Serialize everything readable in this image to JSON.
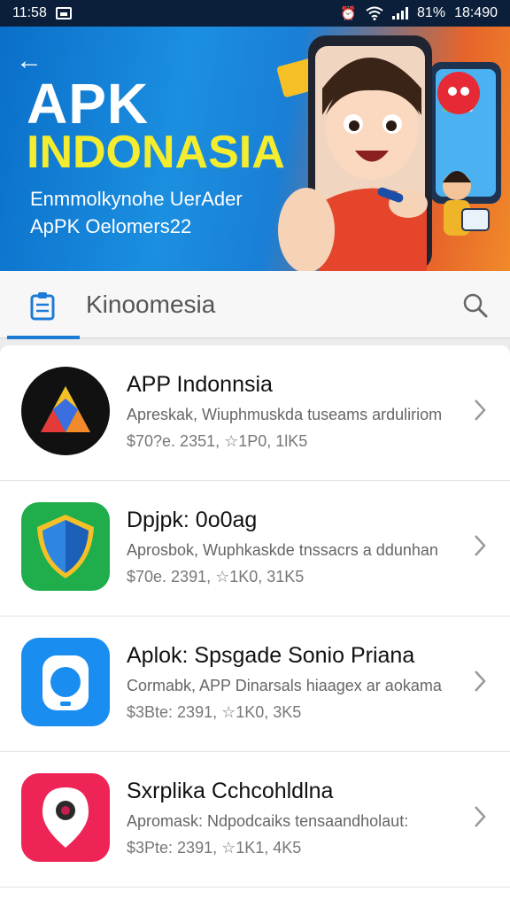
{
  "status_bar": {
    "time": "11:58",
    "battery": "81%",
    "clock_right": "18:490",
    "icons": [
      "gallery-icon",
      "alarm-icon",
      "wifi-icon",
      "signal-icon"
    ]
  },
  "banner": {
    "title_line1": "APK",
    "title_line2": "INDONASIA",
    "subtitle_line1": "Enmmolkynohe UerAder",
    "subtitle_line2": "ApPK Oelomers22",
    "colors": {
      "title_yellow": "#f4ec2e",
      "bg_blue": "#1a7fd6",
      "bg_orange": "#e7642a"
    }
  },
  "search": {
    "text": "Kinoomesia",
    "accent": "#1d7bd6"
  },
  "apps": [
    {
      "title": "APP Indonnsia",
      "description": "Apreskak, Wiuphmuskda tuseams arduliriom",
      "meta": "$70?e. 2351, ☆1P0, 1lK5",
      "icon": "prism-triangle-icon"
    },
    {
      "title": "Dpjpk: 0o0ag",
      "description": "Aprosbok, Wuphkaskde tnssacrs a ddunhan",
      "meta": "$70e. 2391, ☆1K0, 31K5",
      "icon": "shield-icon"
    },
    {
      "title": "Aplok: Spsgade Sonio Priana",
      "description": "Cormabk, APP Dinarsals hiaagex ar aokama",
      "meta": "$3Bte: 2391, ☆1K0, 3K5",
      "icon": "camera-icon"
    },
    {
      "title": "Sxrplika Cchcohldlna",
      "description": "Apromask: Ndpodcaiks tensaandholaut:",
      "meta": "$3Pte: 2391, ☆1K1, 4K5",
      "icon": "location-pin-icon"
    }
  ]
}
